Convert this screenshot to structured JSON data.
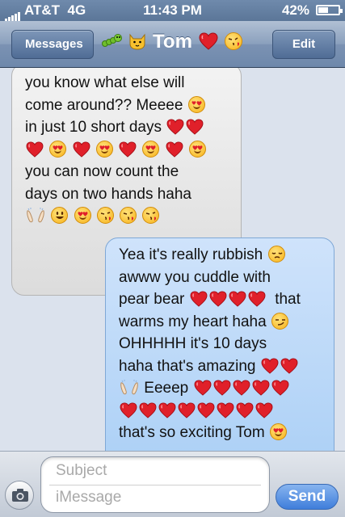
{
  "status_bar": {
    "carrier": "AT&T",
    "network": "4G",
    "time": "11:43 PM",
    "battery": "42%"
  },
  "nav": {
    "back_label": "Messages",
    "title": "Tom",
    "edit_label": "Edit"
  },
  "messages": [
    {
      "direction": "incoming",
      "lines": [
        "you know what else will",
        "come around?? Meeee",
        "in just 10 short days",
        "",
        "you can now count the",
        "days on two hands haha",
        ""
      ]
    },
    {
      "direction": "outgoing",
      "lines": [
        "Yea it's really rubbish",
        "awww you cuddle with",
        "pear bear",
        "that",
        "warms my heart haha",
        "OHHHHH it's 10 days",
        "haha that's amazing",
        "Eeeep",
        "that's so exciting Tom"
      ]
    }
  ],
  "input": {
    "subject_placeholder": "Subject",
    "message_placeholder": "iMessage",
    "send_label": "Send"
  },
  "colors": {
    "heart": "#e0202a",
    "outgoing_bubble": "#a6cdf5",
    "incoming_bubble": "#e6e6e6",
    "send": "#3f7edb"
  }
}
